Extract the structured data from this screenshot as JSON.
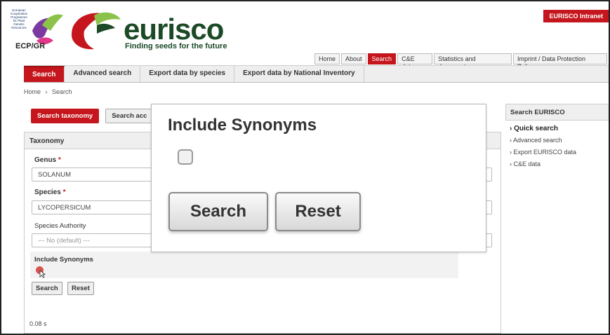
{
  "header": {
    "ecp_lines": [
      "European",
      "Cooperative",
      "Programme",
      "for Plant",
      "Genetic",
      "Resources"
    ],
    "ecp_name": "ECP/GR",
    "logo_word": "eurisco",
    "tagline": "Finding seeds for the future",
    "intranet_label": "EURISCO Intranet"
  },
  "toplinks": [
    "Home",
    "About",
    "Search",
    "C&E data",
    "Statistics and documents",
    "Imprint / Data Protection Policy"
  ],
  "toplinks_active": "Search",
  "navbar": [
    "Search",
    "Advanced search",
    "Export data by species",
    "Export data by National Inventory"
  ],
  "breadcrumb": {
    "home": "Home",
    "sep": "›",
    "current": "Search"
  },
  "subtabs": [
    "Search taxonomy",
    "Search acc"
  ],
  "panel": {
    "title": "Taxonomy",
    "genus_label": "Genus",
    "genus_value": "SOLANUM",
    "species_label": "Species",
    "species_value": "LYCOPERSICUM",
    "required_mark": "*",
    "authority_label": "Species Authority",
    "authority_value": "--- No (default) ---",
    "synonyms_label": "Include Synonyms",
    "search_button": "Search",
    "reset_button": "Reset",
    "timing": "0.08 s"
  },
  "sidebar": {
    "title": "Search EURISCO",
    "items": [
      "› Quick search",
      "› Advanced search",
      "› Export EURISCO data",
      "› C&E data"
    ]
  },
  "zoom": {
    "title": "Include Synonyms",
    "search_button": "Search",
    "reset_button": "Reset"
  },
  "colors": {
    "brand_red": "#c4161c",
    "brand_green": "#1c4a26"
  }
}
